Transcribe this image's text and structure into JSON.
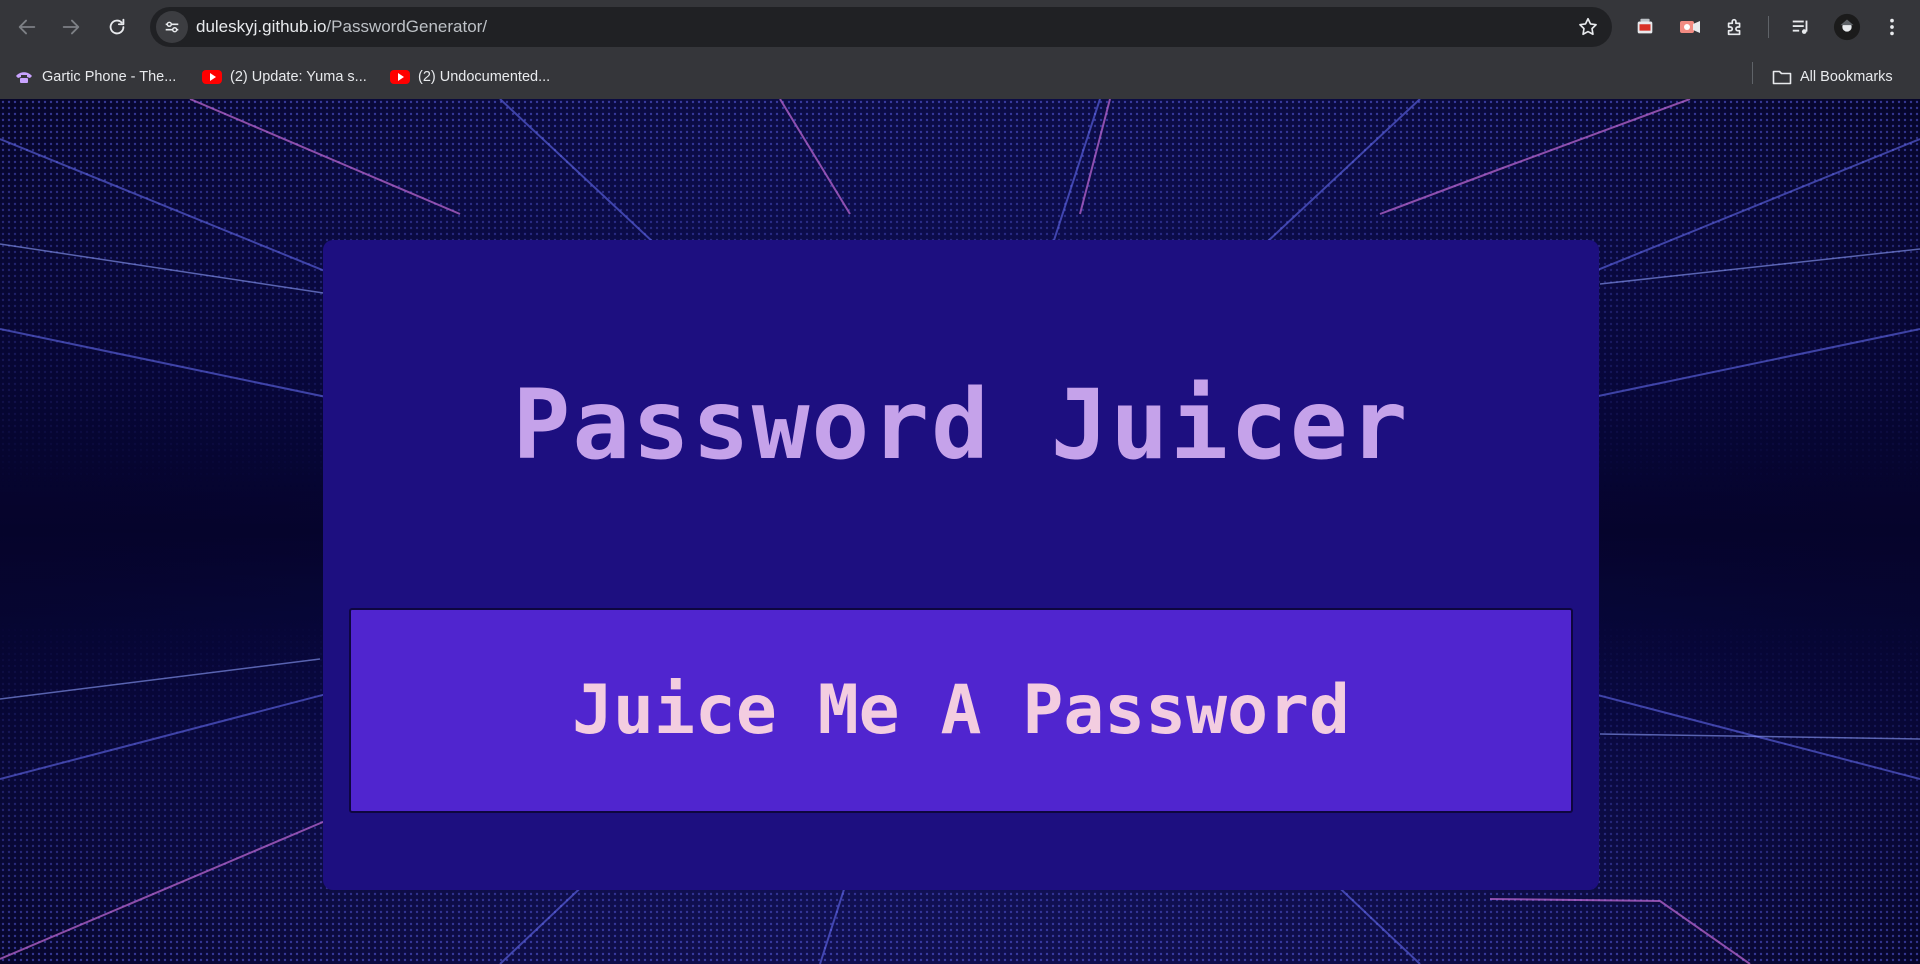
{
  "browser": {
    "url_host": "duleskyj.github.io",
    "url_path": "/PasswordGenerator/",
    "bookmarks": [
      {
        "label": "Gartic Phone - The...",
        "icon": "phone-icon"
      },
      {
        "label": "(2) Update: Yuma s...",
        "icon": "youtube-icon"
      },
      {
        "label": "(2) Undocumented...",
        "icon": "youtube-icon"
      }
    ],
    "all_bookmarks_label": "All Bookmarks"
  },
  "page": {
    "title": "Password Juicer",
    "generate_button_label": "Juice Me A Password"
  },
  "colors": {
    "card_bg": "#1d0f80",
    "title": "#c5a2ea",
    "button_bg": "#5025cf",
    "button_text": "#f3cde0"
  }
}
